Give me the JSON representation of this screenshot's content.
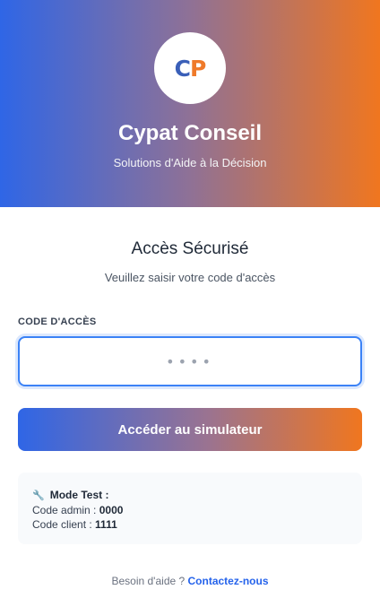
{
  "header": {
    "logo_left": "C",
    "logo_right": "P",
    "brand_name": "Cypat Conseil",
    "tagline": "Solutions d'Aide à la Décision"
  },
  "login": {
    "title": "Accès Sécurisé",
    "subtitle": "Veuillez saisir votre code d'accès",
    "field_label": "CODE D'ACCÈS",
    "placeholder": "••••",
    "value": "",
    "submit_label": "Accéder au simulateur"
  },
  "test_info": {
    "icon": "wrench-icon",
    "heading": "Mode Test :",
    "admin_label": "Code admin : ",
    "admin_code": "0000",
    "client_label": "Code client : ",
    "client_code": "1111"
  },
  "help": {
    "text": "Besoin d'aide ? ",
    "link": "Contactez-nous"
  },
  "colors": {
    "gradient_start": "#2f66e6",
    "gradient_end": "#f0761f",
    "link": "#2563eb",
    "input_focus": "#3b82f6"
  }
}
